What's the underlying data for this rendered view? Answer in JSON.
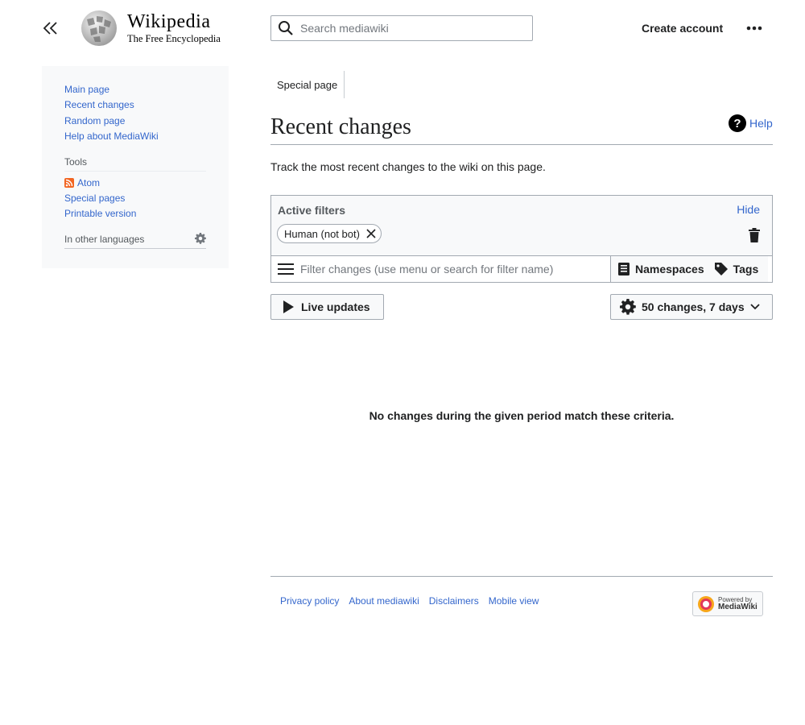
{
  "header": {
    "logo_name": "Wikipedia",
    "logo_tagline": "The Free Encyclopedia",
    "search_placeholder": "Search mediawiki",
    "create_account": "Create account"
  },
  "sidebar": {
    "nav_items": [
      "Main page",
      "Recent changes",
      "Random page",
      "Help about MediaWiki"
    ],
    "tools_title": "Tools",
    "tools_items": [
      "Atom",
      "Special pages",
      "Printable version"
    ],
    "languages_title": "In other languages"
  },
  "main": {
    "tab": "Special page",
    "title": "Recent changes",
    "help": "Help",
    "intro": "Track the most recent changes to the wiki on this page.",
    "active_filters_label": "Active filters",
    "hide_link": "Hide",
    "filter_chip": "Human (not bot)",
    "filter_placeholder": "Filter changes (use menu or search for filter name)",
    "namespaces_button": "Namespaces",
    "tags_button": "Tags",
    "live_updates_button": "Live updates",
    "results_settings_button": "50 changes, 7 days",
    "no_changes_message": "No changes during the given period match these criteria."
  },
  "footer": {
    "links": [
      "Privacy policy",
      "About mediawiki",
      "Disclaimers",
      "Mobile view"
    ],
    "powered_line1": "Powered by",
    "powered_line2": "MediaWiki"
  },
  "icons": {
    "hamburger": "collapse-sidebar-icon",
    "search": "search-icon",
    "more": "ellipsis-icon",
    "help": "help-icon",
    "rss": "rss-icon",
    "gear": "gear-icon",
    "trash": "trash-icon",
    "menu": "menu-icon",
    "namespaces": "book-icon",
    "tags": "tag-icon",
    "play": "play-icon",
    "chevron": "chevron-down-icon"
  },
  "colors": {
    "link": "#3366cc",
    "text": "#202122",
    "border": "#a2a9b1",
    "panel_bg": "#f8f9fa"
  }
}
